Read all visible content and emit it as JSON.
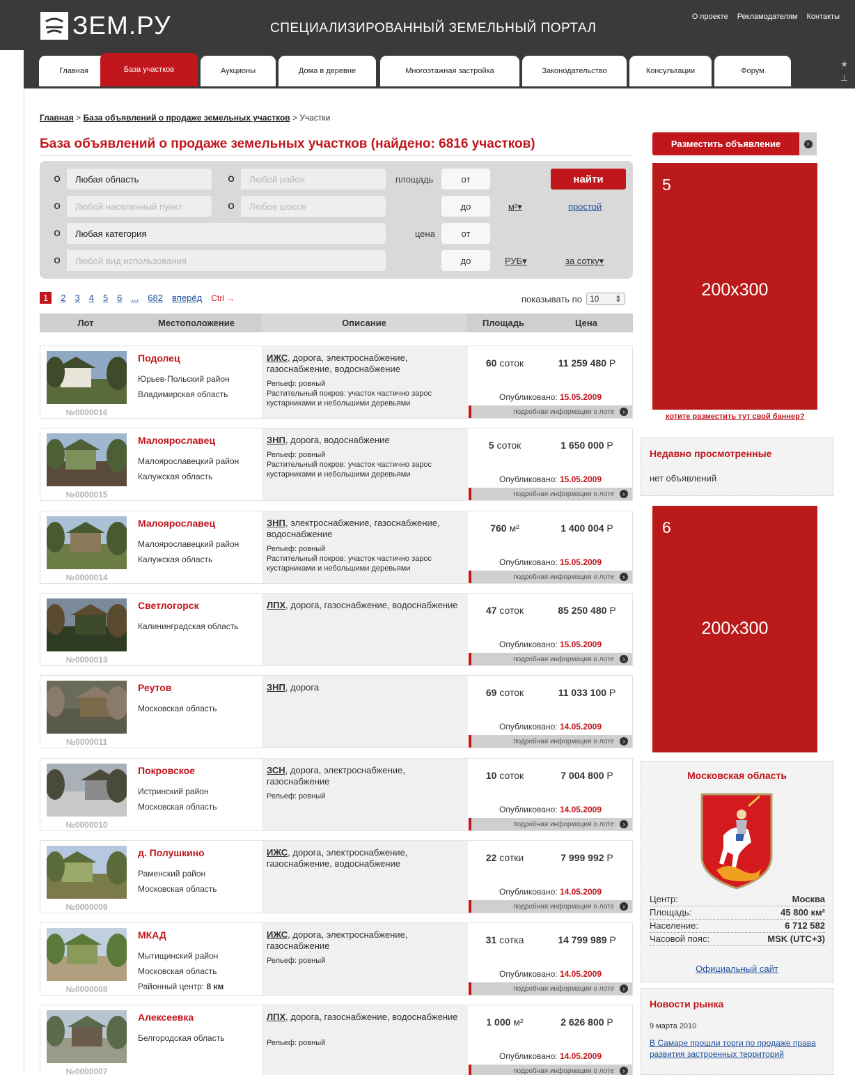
{
  "header": {
    "logo_text": "ЗЕМ.РУ",
    "tagline": "СПЕЦИАЛИЗИРОВАННЫЙ ЗЕМЕЛЬНЫЙ ПОРТАЛ",
    "top_links": [
      "О проекте",
      "Рекламодателям",
      "Контакты"
    ]
  },
  "nav": {
    "tabs": [
      "Главная",
      "База участков",
      "Аукционы",
      "Дома в деревне",
      "Многоэтажная застройка",
      "Законодательство",
      "Консультации",
      "Форум"
    ],
    "active_tab": "База участков"
  },
  "breadcrumb": {
    "home": "Главная",
    "sep1": ">",
    "section": "База объявлений о продаже земельных участков",
    "sep2": ">",
    "current": "Участки"
  },
  "page_title": "База объявлений о продаже земельных участков (найдено: 6816 участков)",
  "search": {
    "btn_glyph": "O",
    "region": "Любая область",
    "district_placeholder": "Любой район",
    "settlement_placeholder": "Любой населенный пункт",
    "highway_placeholder": "Любое шоссе",
    "category": "Любая категория",
    "usage_placeholder": "Любой вид использования",
    "area_label": "площадь",
    "price_label": "цена",
    "from": "от",
    "to": "до",
    "area_unit": "м²▾",
    "currency": "РУБ▾",
    "per_unit": "за сотку▾",
    "find_button": "найти",
    "simple_link": "простой"
  },
  "pagination": {
    "pages": [
      "1",
      "2",
      "3",
      "4",
      "5",
      "6",
      "...",
      "682"
    ],
    "current": "1",
    "next": "вперёд",
    "ctrl_hint": "Ctrl →",
    "per_page_label": "показывать по",
    "per_page_value": "10"
  },
  "table": {
    "headers": [
      "Лот",
      "Местоположение",
      "Описание",
      "Площадь",
      "Цена"
    ],
    "published_label": "Опубликовано:",
    "more_label": "подробная информация о лоте",
    "more_glyph": "›",
    "rows": [
      {
        "lot": "№0000016",
        "city": "Подолец",
        "district": "Юрьев-Польский район",
        "region": "Владимирская область",
        "cat": "ИЖС",
        "cat_rest": ", дорога, электроснабжение, газоснабжение, водоснабжение",
        "relief": "Рельеф: ровный",
        "cover": "Растительный покров: участок частично зарос кустарниками и небольшими деревьями",
        "area_num": "60",
        "area_unit": "соток",
        "price": "11 259 480",
        "currency": "Р",
        "published": "15.05.2009"
      },
      {
        "lot": "№0000015",
        "city": "Малоярославец",
        "district": "Малоярославецкий район",
        "region": "Калужская область",
        "cat": "ЗНП",
        "cat_rest": ", дорога, водоснабжение",
        "relief": "Рельеф: ровный",
        "cover": "Растительный покров: участок частично зарос кустарниками и небольшими деревьями",
        "area_num": "5",
        "area_unit": "соток",
        "price": "1 650 000",
        "currency": "Р",
        "published": "15.05.2009"
      },
      {
        "lot": "№0000014",
        "city": "Малоярославец",
        "district": "Малоярославецкий район",
        "region": "Калужская область",
        "cat": "ЗНП",
        "cat_rest": ", электроснабжение, газоснабжение, водоснабжение",
        "relief": "Рельеф: ровный",
        "cover": "Растительный покров: участок частично зарос кустарниками и небольшими деревьями",
        "area_num": "760",
        "area_unit": "м²",
        "price": "1 400 004",
        "currency": "Р",
        "published": "15.05.2009"
      },
      {
        "lot": "№0000013",
        "city": "Светлогорск",
        "district": "",
        "region": "Калининградская область",
        "cat": "ЛПХ",
        "cat_rest": ", дорога, газоснабжение, водоснабжение",
        "relief": "",
        "cover": "",
        "area_num": "47",
        "area_unit": "соток",
        "price": "85 250 480",
        "currency": "Р",
        "published": "15.05.2009"
      },
      {
        "lot": "№0000011",
        "city": "Реутов",
        "district": "",
        "region": "Московская область",
        "cat": "ЗНП",
        "cat_rest": ", дорога",
        "relief": "",
        "cover": "",
        "area_num": "69",
        "area_unit": "соток",
        "price": "11 033 100",
        "currency": "Р",
        "published": "14.05.2009"
      },
      {
        "lot": "№0000010",
        "city": "Покровское",
        "district": "Истринский район",
        "region": "Московская область",
        "cat": "ЗСН",
        "cat_rest": ", дорога, электроснабжение, газоснабжение",
        "relief": "Рельеф: ровный",
        "cover": "",
        "area_num": "10",
        "area_unit": "соток",
        "price": "7 004 800",
        "currency": "Р",
        "published": "14.05.2009"
      },
      {
        "lot": "№0000009",
        "city": "д. Полушкино",
        "district": "Раменский район",
        "region": "Московская область",
        "cat": "ИЖС",
        "cat_rest": ", дорога, электроснабжение, газоснабжение, водоснабжение",
        "relief": "",
        "cover": "",
        "area_num": "22",
        "area_unit": "сотки",
        "price": "7 999 992",
        "currency": "Р",
        "published": "14.05.2009"
      },
      {
        "lot": "№0000008",
        "city": "МКАД",
        "district": "Мытищинский район",
        "region": "Московская область",
        "district_center_label": "Районный центр:",
        "district_center_value": "8 км",
        "cat": "ИЖС",
        "cat_rest": ", дорога, электроснабжение, газоснабжение",
        "relief": "Рельеф: ровный",
        "cover": "",
        "area_num": "31",
        "area_unit": "сотка",
        "price": "14 799 989",
        "currency": "Р",
        "published": "14.05.2009"
      },
      {
        "lot": "№0000007",
        "city": "Алексеевка",
        "district": "",
        "region": "Белгородская область",
        "cat": "ЛПХ",
        "cat_rest": ", дорога, газоснабжение, водоснабжение",
        "relief": "Рельеф: ровный",
        "cover": "",
        "area_num": "1 000",
        "area_unit": "м²",
        "price": "2 626 800",
        "currency": "Р",
        "published": "14.05.2009"
      }
    ]
  },
  "sidebar": {
    "post_button": "Разместить объявление",
    "post_button_glyph": "›",
    "banner1": {
      "num": "5",
      "size": "200x300"
    },
    "banner_link": "хотите разместить тут свой баннер?",
    "recent": {
      "title": "Недавно просмотренные",
      "body": "нет объявлений"
    },
    "banner2": {
      "num": "6",
      "size": "200x300"
    },
    "region": {
      "title": "Московская область",
      "info": [
        {
          "label": "Центр:",
          "value": "Москва"
        },
        {
          "label": "Площадь:",
          "value": "45 800 км²"
        },
        {
          "label": "Население:",
          "value": "6 712 582"
        },
        {
          "label": "Часовой пояс:",
          "value": "MSK (UTC+3)"
        }
      ],
      "site_link": "Официальный сайт"
    },
    "news": {
      "title": "Новости рынка",
      "date": "9 марта 2010",
      "link": "В Самаре прошли торги по продаже права развития застроенных территорий"
    }
  },
  "colors": {
    "accent": "#c1161c",
    "header_bg": "#3a3a3a",
    "link": "#1e4f9c"
  }
}
